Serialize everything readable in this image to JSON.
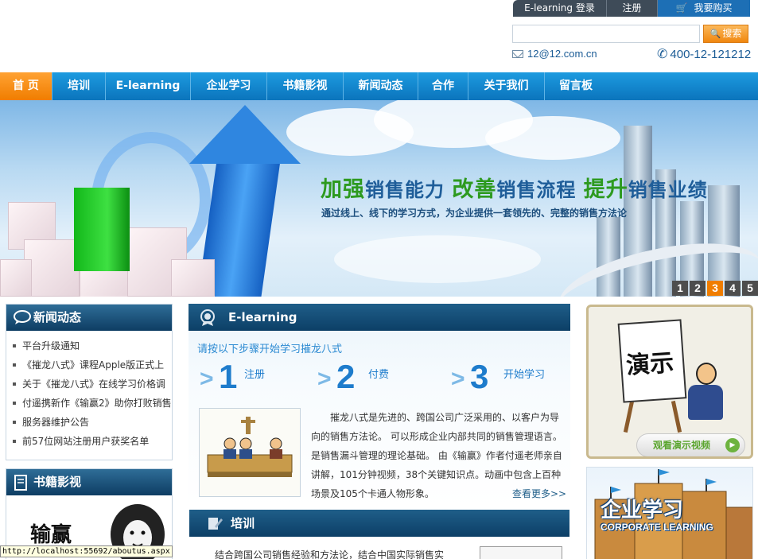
{
  "topbar": {
    "elearning_login": "E-learning 登录",
    "register": "注册",
    "buy": "我要购买"
  },
  "search": {
    "button": "搜索",
    "placeholder": ""
  },
  "contact": {
    "email": "12@12.com.cn",
    "phone": "400-12-121212"
  },
  "nav": {
    "items": [
      "首 页",
      "培训",
      "E-learning",
      "企业学习",
      "书籍影视",
      "新闻动态",
      "合作",
      "关于我们",
      "留言板"
    ],
    "active_index": 0
  },
  "banner": {
    "headline": {
      "w1": "加强",
      "p1": "销售能力 ",
      "w2": "改善",
      "p2": "销售流程 ",
      "w3": "提升",
      "p3": "销售业绩"
    },
    "sub": "通过线上、线下的学习方式，为企业提供一套领先的、完整的销售方法论",
    "pages": [
      "1",
      "2",
      "3",
      "4",
      "5"
    ],
    "active_page": 3
  },
  "news": {
    "title": "新闻动态",
    "items": [
      "平台升级通知",
      "《摧龙八式》课程Apple版正式上",
      "关于《摧龙八式》在线学习价格调",
      "付遥携新作《输赢2》助你打败销售",
      "服务器维护公告",
      "前57位网站注册用户获奖名单"
    ]
  },
  "books": {
    "title": "书籍影视",
    "cover_text": "输赢"
  },
  "elearning": {
    "title": "E-learning",
    "steps_title": "请按以下步骤开始学习摧龙八式",
    "steps": [
      {
        "num": "1",
        "label": "注册"
      },
      {
        "num": "2",
        "label": "付费"
      },
      {
        "num": "3",
        "label": "开始学习"
      }
    ],
    "description": "摧龙八式是先进的、跨国公司广泛采用的、以客户为导向的销售方法论。 可以形成企业内部共同的销售管理语言。是销售漏斗管理的理论基础。 由《输赢》作者付遥老师亲自讲解，101分钟视频，38个关键知识点。动画中包含上百种场景及105个卡通人物形象。",
    "more": "查看更多>>"
  },
  "training": {
    "title": "培训",
    "text": "结合跨国公司销售经验和方法论，结合中国实际销售实"
  },
  "demo": {
    "board_text": "演示",
    "button": "观看演示视频"
  },
  "corporate": {
    "cn": "企业学习",
    "en": "CORPORATE LEARNING"
  },
  "statusbar": {
    "url": "http://localhost:55692/aboutus.aspx"
  },
  "colors": {
    "nav_active": "#f07d00",
    "nav_bg": "#0b74bc",
    "box_head": "#0e3d63",
    "accent_green": "#2d9a1f"
  }
}
